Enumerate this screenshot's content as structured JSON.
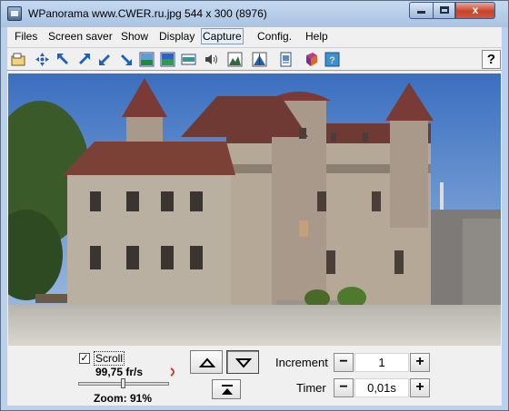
{
  "window": {
    "title": "WPanorama  www.CWER.ru.jpg   544 x 300 (8976)",
    "minimize_label": "",
    "maximize_label": "",
    "close_label": "x"
  },
  "menu": {
    "items": [
      {
        "label": "Files"
      },
      {
        "label": "Screen saver"
      },
      {
        "label": "Show"
      },
      {
        "label": "Display"
      },
      {
        "label": "Capture"
      },
      {
        "label": "Config."
      },
      {
        "label": "Help"
      }
    ],
    "active_item": "Capture"
  },
  "toolbar": {
    "buttons": [
      "open-icon",
      "center-view-icon",
      "scroll-up-left-icon",
      "scroll-up-right-icon",
      "scroll-down-left-icon",
      "scroll-down-right-icon",
      "panorama-bottom-icon",
      "panorama-top-icon",
      "panorama-fit-icon",
      "sound-icon",
      "landscape-icon",
      "landscape-center-icon",
      "document-icon",
      "book-icon",
      "info-icon"
    ],
    "help_label": "?"
  },
  "controls": {
    "scroll_checked": true,
    "scroll_label": "Scroll",
    "check_mark": "✓",
    "fps": "99,75 fr/s",
    "zoom_label": "Zoom: 91%",
    "zoom_fraction": 0.5,
    "increment_label": "Increment",
    "increment_value": "1",
    "timer_label": "Timer",
    "timer_value": "0,01s",
    "minus_label": "−",
    "plus_label": "+"
  },
  "colors": {
    "sky": "#5b86c8",
    "tower_roof": "#7a3a35",
    "stone": "#b9b0a2",
    "accent_red": "#c7432c"
  }
}
